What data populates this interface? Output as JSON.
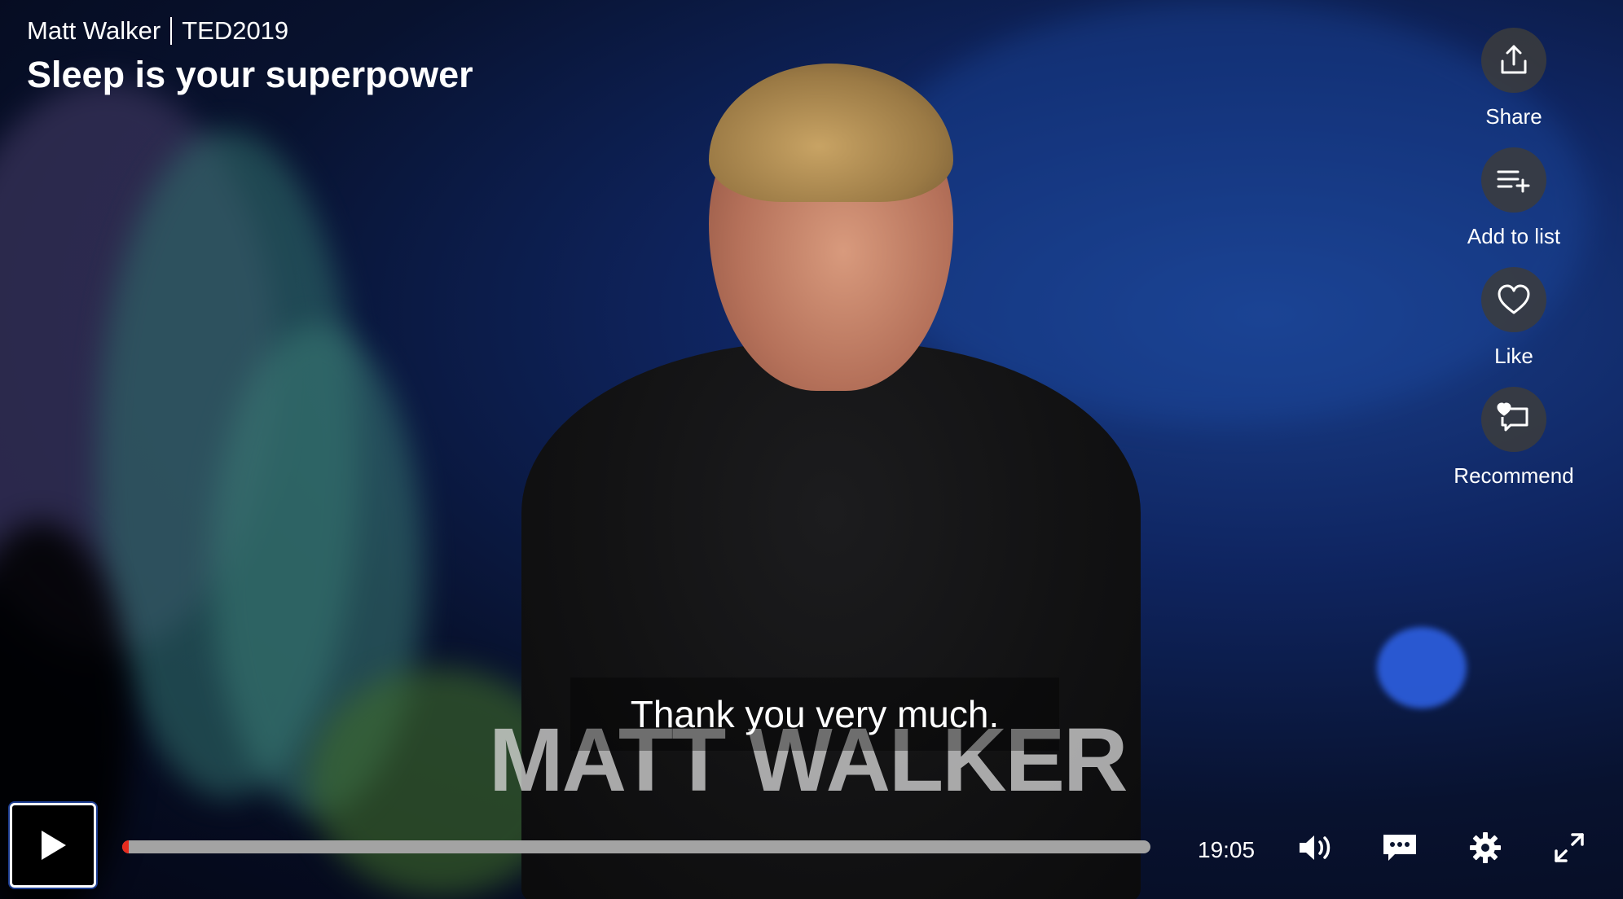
{
  "talk": {
    "speaker": "Matt Walker",
    "event": "TED2019",
    "title": "Sleep is your superpower"
  },
  "actions": [
    {
      "icon": "share-icon",
      "label": "Share"
    },
    {
      "icon": "add-to-list-icon",
      "label": "Add to list"
    },
    {
      "icon": "heart-icon",
      "label": "Like"
    },
    {
      "icon": "recommend-icon",
      "label": "Recommend"
    }
  ],
  "video_overlay": {
    "lower_third_text": "MATT WALKER"
  },
  "caption": {
    "text": "Thank you very much."
  },
  "player": {
    "duration": "19:05",
    "progress_fraction": 0.005,
    "controls": [
      "play-icon",
      "volume-icon",
      "subtitles-icon",
      "settings-gear-icon",
      "fullscreen-icon"
    ]
  },
  "colors": {
    "progress_played": "#e62b1e",
    "progress_track": "#a3a3a3",
    "action_circle": "#3c3c3c"
  }
}
